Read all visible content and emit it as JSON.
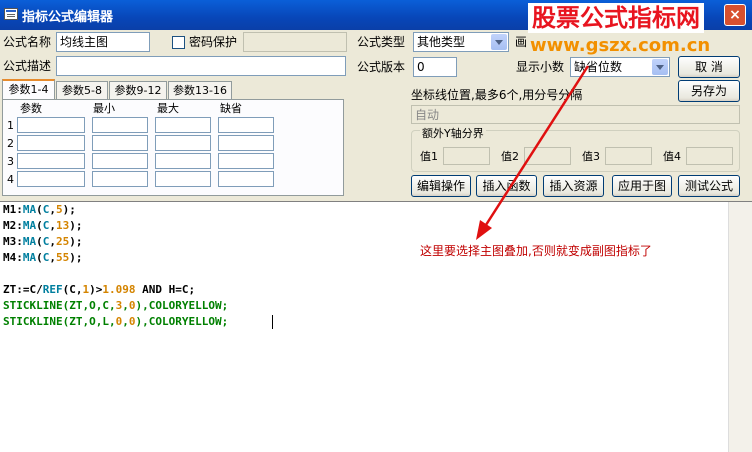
{
  "window": {
    "title": "指标公式编辑器",
    "close_label": "×"
  },
  "watermark": {
    "title": "股票公式指标网",
    "url": "www.gszx.com.cn"
  },
  "form": {
    "name_label": "公式名称",
    "name_value": "均线主图",
    "password_label": "密码保护",
    "desc_label": "公式描述",
    "desc_value": "",
    "type_label": "公式类型",
    "type_value": "其他类型",
    "draw_label": "画",
    "version_label": "公式版本",
    "version_value": "0",
    "decimals_label": "显示小数",
    "decimals_value": "缺省位数"
  },
  "buttons": {
    "cancel": "取  消",
    "save_as": "另存为",
    "edit_ops": "编辑操作",
    "insert_func": "插入函数",
    "insert_res": "插入资源",
    "apply_chart": "应用于图",
    "test_formula": "测试公式"
  },
  "tabs": [
    "参数1-4",
    "参数5-8",
    "参数9-12",
    "参数13-16"
  ],
  "params": {
    "headers": [
      "参数",
      "最小",
      "最大",
      "缺省"
    ],
    "rows": [
      "1",
      "2",
      "3",
      "4"
    ]
  },
  "axis": {
    "label": "坐标线位置,最多6个,用分号分隔",
    "value": "自动"
  },
  "y_axis": {
    "title": "额外Y轴分界",
    "labels": [
      "值1",
      "值2",
      "值3",
      "值4"
    ]
  },
  "code": {
    "line1": {
      "a": "M1:",
      "b": "MA",
      "c": "(",
      "d": "C",
      "e": ",",
      "f": "5",
      "g": ");"
    },
    "line2": {
      "a": "M2:",
      "b": "MA",
      "c": "(",
      "d": "C",
      "e": ",",
      "f": "13",
      "g": ");"
    },
    "line3": {
      "a": "M3:",
      "b": "MA",
      "c": "(",
      "d": "C",
      "e": ",",
      "f": "25",
      "g": ");"
    },
    "line4": {
      "a": "M4:",
      "b": "MA",
      "c": "(",
      "d": "C",
      "e": ",",
      "f": "55",
      "g": ");"
    },
    "line6": {
      "a": "ZT:=C/",
      "b": "REF",
      "c": "(C,",
      "d": "1",
      "e": ")>",
      "f": "1.098",
      "g": " AND H=C;"
    },
    "line7": {
      "a": "STICKLINE",
      "b": "(ZT,",
      "c": "O",
      "d": ",C,",
      "e": "3",
      "f": ",",
      "g": "0",
      "h": "),",
      "i": "COLORYELLOW",
      "j": ";"
    },
    "line8": {
      "a": "STICKLINE",
      "b": "(ZT,",
      "c": "O",
      "d": ",L,",
      "e": "0",
      "f": ",",
      "g": "0",
      "h": "),",
      "i": "COLORYELLOW",
      "j": ";"
    }
  },
  "annotation": "这里要选择主图叠加,否则就变成副图指标了",
  "colors": {
    "annotation": "#c00000",
    "arrow": "#e01010",
    "watermark_title": "#e8141f",
    "watermark_url": "#f29000"
  }
}
